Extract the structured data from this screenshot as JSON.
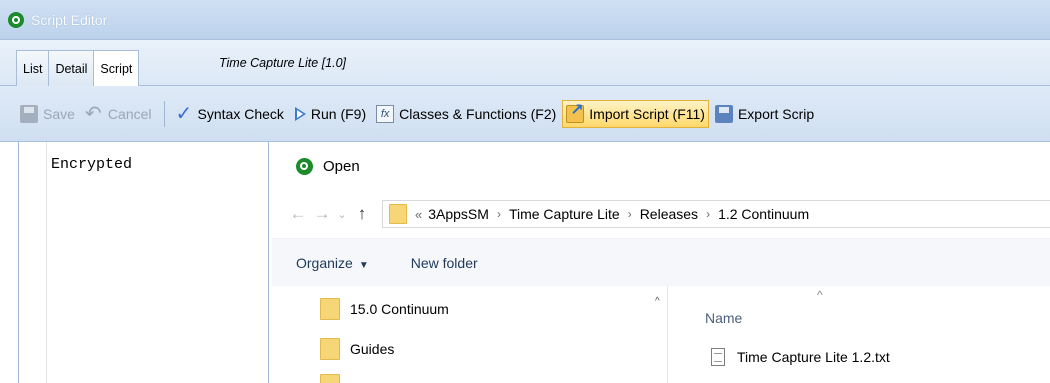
{
  "window": {
    "title": "Script Editor"
  },
  "tabs": [
    {
      "label": "List"
    },
    {
      "label": "Detail"
    },
    {
      "label": "Script"
    }
  ],
  "document_title": "Time Capture Lite [1.0]",
  "toolbar": {
    "save_label": "Save",
    "cancel_label": "Cancel",
    "syntax_check_label": "Syntax Check",
    "run_label": "Run (F9)",
    "classes_functions_label": "Classes & Functions (F2)",
    "import_label": "Import Script (F11)",
    "export_label": "Export Scrip"
  },
  "editor": {
    "content": "Encrypted"
  },
  "dialog": {
    "title": "Open",
    "breadcrumb": {
      "overflow": "«",
      "items": [
        "3AppsSM",
        "Time Capture Lite",
        "Releases",
        "1.2 Continuum"
      ]
    },
    "commands": {
      "organize_label": "Organize",
      "new_folder_label": "New folder"
    },
    "tree": [
      {
        "label": "15.0 Continuum"
      },
      {
        "label": "Guides"
      }
    ],
    "columns": {
      "name": "Name"
    },
    "files": [
      {
        "name": "Time Capture Lite 1.2.txt"
      }
    ]
  }
}
